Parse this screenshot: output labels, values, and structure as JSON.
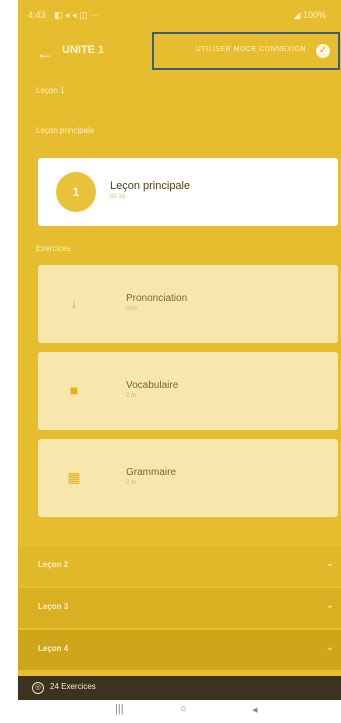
{
  "status_bar": {
    "time": "4:43",
    "icons": "◧ ◂ ◂ ◫ ···",
    "right": "◢ 100%"
  },
  "header": {
    "back_icon": "←",
    "unit_title": "UNITE 1",
    "confirm_label": "UTILISER MODE CONNEXION",
    "check_icon": "✓"
  },
  "lesson_1": {
    "label": "Leçon 1"
  },
  "principal_section": {
    "label": "Leçon principale",
    "card_number": "1",
    "card_title": "Leçon principale",
    "card_subtitle": "02:15"
  },
  "exercises_section": {
    "label": "Exercices",
    "items": [
      {
        "icon": "↓",
        "title": "Prononciation",
        "subtitle": "03m"
      },
      {
        "icon": "■",
        "title": "Vocabulaire",
        "subtitle": "2 m"
      },
      {
        "icon": "▦",
        "title": "Grammaire",
        "subtitle": "2 m"
      }
    ]
  },
  "other_lessons": [
    {
      "label": "Leçon 2",
      "chevron": "⌄"
    },
    {
      "label": "Leçon 3",
      "chevron": "⌄"
    },
    {
      "label": "Leçon 4",
      "chevron": "⌄"
    }
  ],
  "footer": {
    "icon": "◎",
    "label": "24 Exercices"
  },
  "nav": {
    "recent": "|||",
    "home": "○",
    "back": "◂"
  },
  "colors": {
    "accent": "#e6bd2e",
    "card_white": "#ffffff",
    "card_light": "#f7e7ad",
    "footer": "#3b321f",
    "highlight_border": "#3a5f7a"
  }
}
